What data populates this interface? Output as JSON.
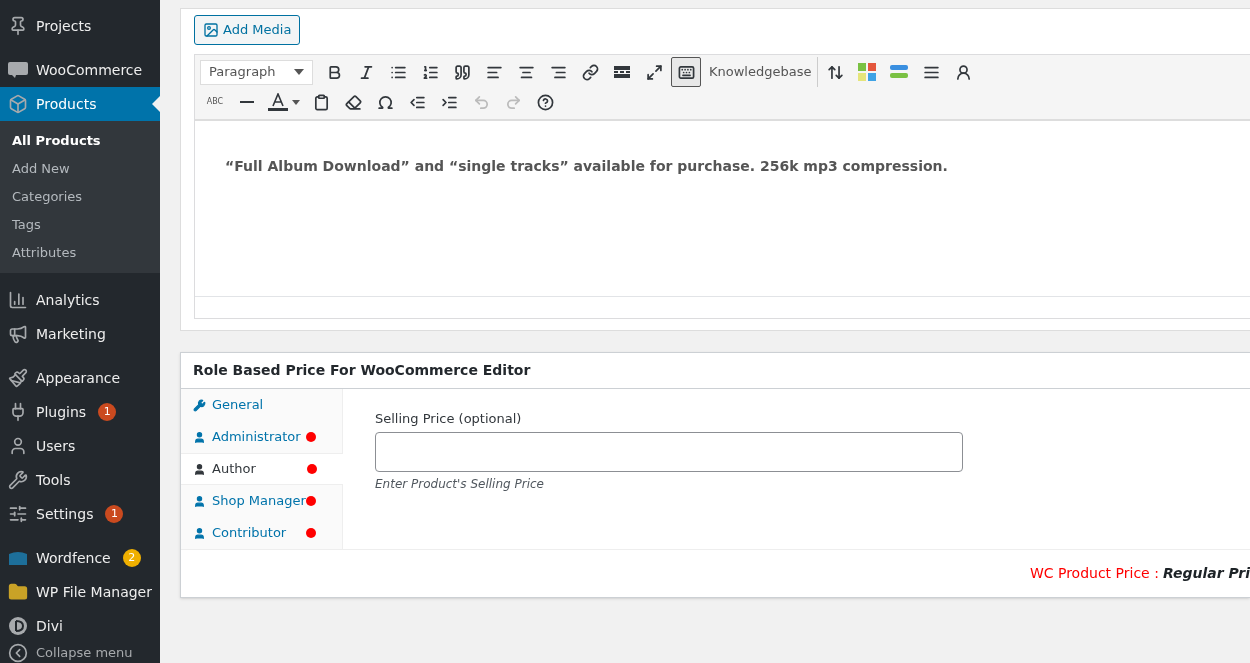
{
  "sidebar": {
    "items": [
      {
        "label": "Projects",
        "selected": false
      },
      {
        "label": "WooCommerce",
        "selected": false
      },
      {
        "label": "Products",
        "selected": true,
        "children": [
          {
            "label": "All Products",
            "selected": true
          },
          {
            "label": "Add New",
            "selected": false
          },
          {
            "label": "Categories",
            "selected": false
          },
          {
            "label": "Tags",
            "selected": false
          },
          {
            "label": "Attributes",
            "selected": false
          }
        ]
      },
      {
        "label": "Analytics",
        "selected": false
      },
      {
        "label": "Marketing",
        "selected": false
      },
      {
        "label": "Appearance",
        "selected": false
      },
      {
        "label": "Plugins",
        "selected": false,
        "badge": "1",
        "color": "#ca4a1f"
      },
      {
        "label": "Users",
        "selected": false
      },
      {
        "label": "Tools",
        "selected": false
      },
      {
        "label": "Settings",
        "selected": false,
        "badge": "1",
        "color": "#ca4a1f"
      },
      {
        "label": "Wordfence",
        "selected": false,
        "badge": "2",
        "color": "#f0b000"
      },
      {
        "label": "WP File Manager",
        "selected": false
      },
      {
        "label": "Divi",
        "selected": false
      }
    ],
    "collapse": "Collapse menu"
  },
  "editor": {
    "add_media": "Add Media",
    "format": "Paragraph",
    "strike_label": "ABC",
    "knowledgebase": "Knowledgebase",
    "content": "“Full Album Download” and “single tracks” available for purchase. 256k mp3 compression."
  },
  "role_panel": {
    "title": "Role Based Price For WooCommerce Editor",
    "tabs": [
      {
        "label": "General",
        "kind": "settings",
        "selected": false,
        "flagged": false
      },
      {
        "label": "Administrator",
        "kind": "role",
        "selected": false,
        "flagged": true
      },
      {
        "label": "Author",
        "kind": "role",
        "selected": true,
        "flagged": true
      },
      {
        "label": "Shop Manager",
        "kind": "role",
        "selected": false,
        "flagged": true
      },
      {
        "label": "Contributor",
        "kind": "role",
        "selected": false,
        "flagged": true
      }
    ],
    "field_label": "Selling Price (optional)",
    "field_hint": "Enter Product's Selling Price",
    "footer_label": "WC Product Price :",
    "footer_value": "Regular Pri"
  }
}
